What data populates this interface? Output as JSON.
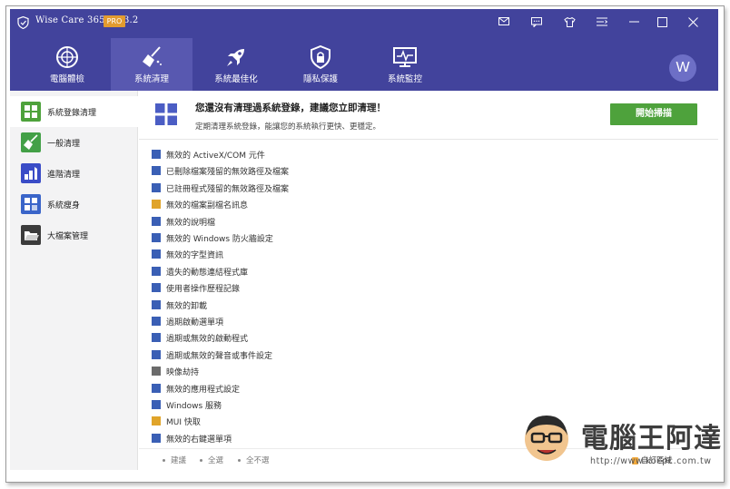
{
  "window": {
    "title": "Wise Care 365 - 5.3.2",
    "badge": "PRO"
  },
  "titlebar_icons": [
    "mail-icon",
    "chat-icon",
    "tshirt-icon",
    "menu-icon",
    "minimize-icon",
    "maximize-icon",
    "close-icon"
  ],
  "nav": {
    "tabs": [
      {
        "label": "電腦體檢",
        "icon": "checkup-icon"
      },
      {
        "label": "系統清理",
        "icon": "broom-icon",
        "active": true
      },
      {
        "label": "系統最佳化",
        "icon": "rocket-icon"
      },
      {
        "label": "隱私保護",
        "icon": "lock-icon"
      },
      {
        "label": "系統監控",
        "icon": "monitor-icon"
      }
    ],
    "avatar_letter": "W"
  },
  "sidebar": {
    "items": [
      {
        "label": "系統登錄清理",
        "icon": "registry-icon",
        "color": "#4ea23c",
        "active": true
      },
      {
        "label": "一般清理",
        "icon": "broom-icon",
        "color": "#43a047"
      },
      {
        "label": "進階清理",
        "icon": "advanced-clean-icon",
        "color": "#3a4cc7"
      },
      {
        "label": "系統瘦身",
        "icon": "slim-icon",
        "color": "#3a65c9"
      },
      {
        "label": "大檔案管理",
        "icon": "folder-icon",
        "color": "#3b3b3b"
      }
    ]
  },
  "header": {
    "title": "您還沒有清理過系統登錄，建議您立即清理！",
    "subtitle": "定期清理系統登錄，能讓您的系統執行更快、更穩定。",
    "scan_button": "開始掃描"
  },
  "registry_items": [
    {
      "label": "無效的 ActiveX/COM 元件",
      "color": "#3a5fb5"
    },
    {
      "label": "已刪除檔案殘留的無效路徑及檔案",
      "color": "#3a5fb5"
    },
    {
      "label": "已註冊程式殘留的無效路徑及檔案",
      "color": "#3a5fb5"
    },
    {
      "label": "無效的檔案副檔名訊息",
      "color": "#e0a42a"
    },
    {
      "label": "無效的說明檔",
      "color": "#3a5fb5"
    },
    {
      "label": "無效的 Windows 防火牆設定",
      "color": "#3a5fb5"
    },
    {
      "label": "無效的字型資訊",
      "color": "#3a5fb5"
    },
    {
      "label": "遺失的動態連結程式庫",
      "color": "#3a5fb5"
    },
    {
      "label": "使用者操作歷程記錄",
      "color": "#3a5fb5"
    },
    {
      "label": "無效的卸載",
      "color": "#3a5fb5"
    },
    {
      "label": "過期啟動選單項",
      "color": "#3a5fb5"
    },
    {
      "label": "過期或無效的啟動程式",
      "color": "#3a5fb5"
    },
    {
      "label": "過期或無效的聲音或事件設定",
      "color": "#3a5fb5"
    },
    {
      "label": "映像劫持",
      "color": "#6b6b6b"
    },
    {
      "label": "無效的應用程式設定",
      "color": "#3a5fb5"
    },
    {
      "label": "Windows 服務",
      "color": "#3a5fb5"
    },
    {
      "label": "MUI 快取",
      "color": "#e0a42a"
    },
    {
      "label": "無效的右鍵選單項",
      "color": "#3a5fb5"
    }
  ],
  "footer": {
    "links": [
      "建議",
      "全選",
      "全不選"
    ],
    "right_label": "自訂區域"
  },
  "watermark": {
    "text": "電腦王阿達",
    "url": "http://www.kocpc.com.tw"
  }
}
